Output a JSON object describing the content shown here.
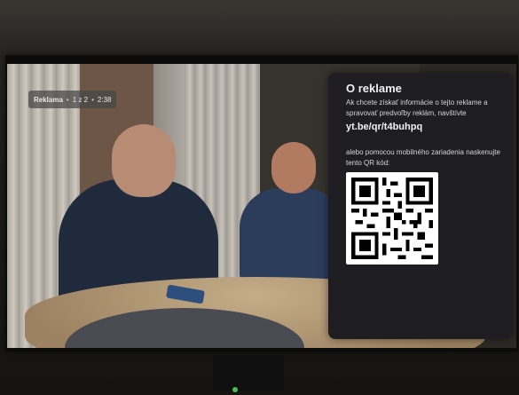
{
  "ad_badge": {
    "label": "Reklama",
    "position": "1 z 2",
    "time": "2:38",
    "separator": "•"
  },
  "ad_info_panel": {
    "title": "O reklame",
    "description": "Ak chcete získať informácie o tejto reklame a spravovať predvoľby reklám, navštívte",
    "link": "yt.be/qr/t4buhpq",
    "qr_instruction": "alebo pomocou mobilného zariadenia naskenujte tento QR kód:",
    "qr_icon": "qr-code-icon"
  },
  "colors": {
    "panel_bg": "#1e1e22",
    "chip_bg": "#464646",
    "led": "#4dbb5a"
  }
}
